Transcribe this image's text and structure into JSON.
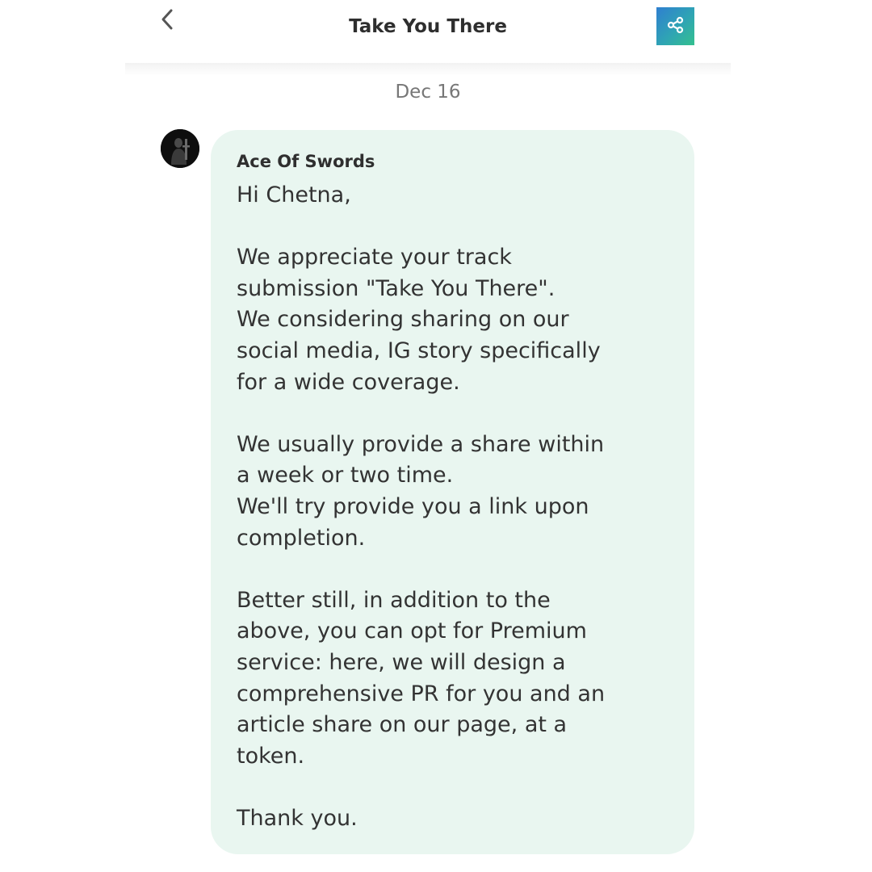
{
  "header": {
    "title": "Take You There",
    "back_icon": "chevron-left-icon",
    "share_icon": "share-icon",
    "share_button_colors": [
      "#2f7fd0",
      "#34c08e"
    ]
  },
  "conversation": {
    "date": "Dec 16",
    "message": {
      "sender": "Ace Of Swords",
      "bubble_color": "#e9f6f0",
      "paragraphs": [
        "Hi Chetna,",
        "We appreciate your track\nsubmission \"Take You There\".\nWe considering sharing on our\nsocial media, IG story specifically\nfor a wide coverage.",
        "We usually provide a share within\na week or two time.\nWe'll try provide you a link upon\ncompletion.",
        "Better still, in addition to the\nabove, you can opt for Premium\nservice: here, we will design a\ncomprehensive PR for you and an\narticle share on our page, at a\ntoken.",
        "Thank you."
      ]
    }
  }
}
